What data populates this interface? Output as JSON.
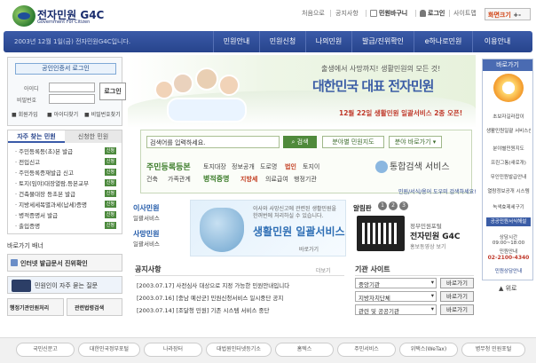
{
  "header": {
    "logo_title": "전자민원 G4C",
    "logo_sub": "Government For Citizen",
    "util": [
      "처음으로",
      "공지사항",
      "민원바구니",
      "로그인",
      "사이트맵"
    ],
    "font_size": "화면크기"
  },
  "nav": {
    "date": "2003년 12월 1일(금) 전자민원G4C입니다.",
    "tabs": [
      "민원안내",
      "민원신청",
      "나의민원",
      "발급/진위확인",
      "e하나로민원",
      "이용안내"
    ]
  },
  "login": {
    "cert": "공인인증서 로그인",
    "id_label": "아이디",
    "pw_label": "비밀번호",
    "button": "로그인",
    "links": [
      "회원가입",
      "아이디찾기",
      "비밀번호찾기"
    ]
  },
  "service": {
    "tabs": [
      "자주 찾는 민원",
      "신청한 민원"
    ],
    "items": [
      "주민등록등(초)본 발급",
      "전입신고",
      "주민등록증재발급 신고",
      "토지(임야)대장열람,등본교부",
      "건축물대장 등초본 발급",
      "지방세세목별과세(납세)증명",
      "병적증명서 발급",
      "출입증명"
    ],
    "badge": "신청",
    "more": "더보기"
  },
  "left_bottom": {
    "banner_label": "바로가기 배너",
    "box1": "인터넷 발급문서 진위확인",
    "box2": "민원인이 자주 묻는 질문",
    "box3": "행정기관민원처리",
    "box4": "관련법령검색"
  },
  "banner": {
    "slogan": "출생에서 사망까지! 생활민원의 모든 것!",
    "title": "대한민국 대표 전자민원",
    "notice": "12월 22일 생활민원 일괄서비스 2종 오픈!"
  },
  "search": {
    "input_value": "검색어를 입력하세요.",
    "search_btn": "검색",
    "cat_btn": "분야별 민원지도",
    "quick_btn": "분야 바로가기",
    "keywords_row1": [
      "주민등록등본",
      "토지대장",
      "정보공개",
      "도로명",
      "법인",
      "토지이"
    ],
    "keywords_row2": [
      "건축",
      "가족관계",
      "병적증명",
      "지방세",
      "의료급여",
      "행정기관"
    ],
    "integrated": "통합검색 서비스",
    "guide_link": "민원/서식/용어 도우미 검색하세요!"
  },
  "mid": {
    "civil1": "이사민원",
    "civil1_sub": "일괄서비스",
    "civil2": "사망민원",
    "civil2_sub": "일괄서비스",
    "ad_text": "이사와 사망신고에 관련된 생활민원을 한꺼번에 처리하실 수 있습니다.",
    "ad_big": "생활민원 일괄서비스",
    "ad_more": "바로가기",
    "album_title": "알림판",
    "album_nums": [
      "1",
      "2",
      "3"
    ],
    "album_cap1": "정부민원포털",
    "album_cap2": "전자민원 G4C",
    "album_cap3": "홍보동영상 보기"
  },
  "notices": {
    "title": "공지사항",
    "more": "더보기",
    "rows": [
      "[2003.07.17] 사전심사 대상으로 지정 가능한 민원안내입니다",
      "[2003.07.16] [충남 예산군] 민원신청서비스 일시중단 공지",
      "[2003.07.14] [조달청 민원] 기존 시스템 서비스 중단"
    ]
  },
  "sites": {
    "title": "기관 사이트",
    "selects": [
      "중앙기관",
      "지방자치단체",
      "관련 및 공공기관"
    ],
    "go": "바로가기"
  },
  "rail": {
    "header": "바로가기",
    "items": [
      "초보자길라잡이",
      "생활민원일괄 서비스신청하기",
      "분야별민원지도",
      "프린그통(새로개)",
      "무인민원발급안내",
      "열람정보공개 시스템",
      "녹색효제세구기",
      "공공민원서식해설"
    ],
    "phone_label": "상담시간",
    "phone_hours": "09:00~18:00",
    "phone_tel_label": "민원안내",
    "phone": "02-2100-4340",
    "consult": "민원상담안내",
    "top": "위로"
  },
  "footer": [
    "국민신문고",
    "대한민국정부포털",
    "나라장터",
    "대법원인터넷등기소",
    "홈텍스",
    "주민서비스",
    "위택스(WeTax)",
    "병무청 민원포털"
  ]
}
